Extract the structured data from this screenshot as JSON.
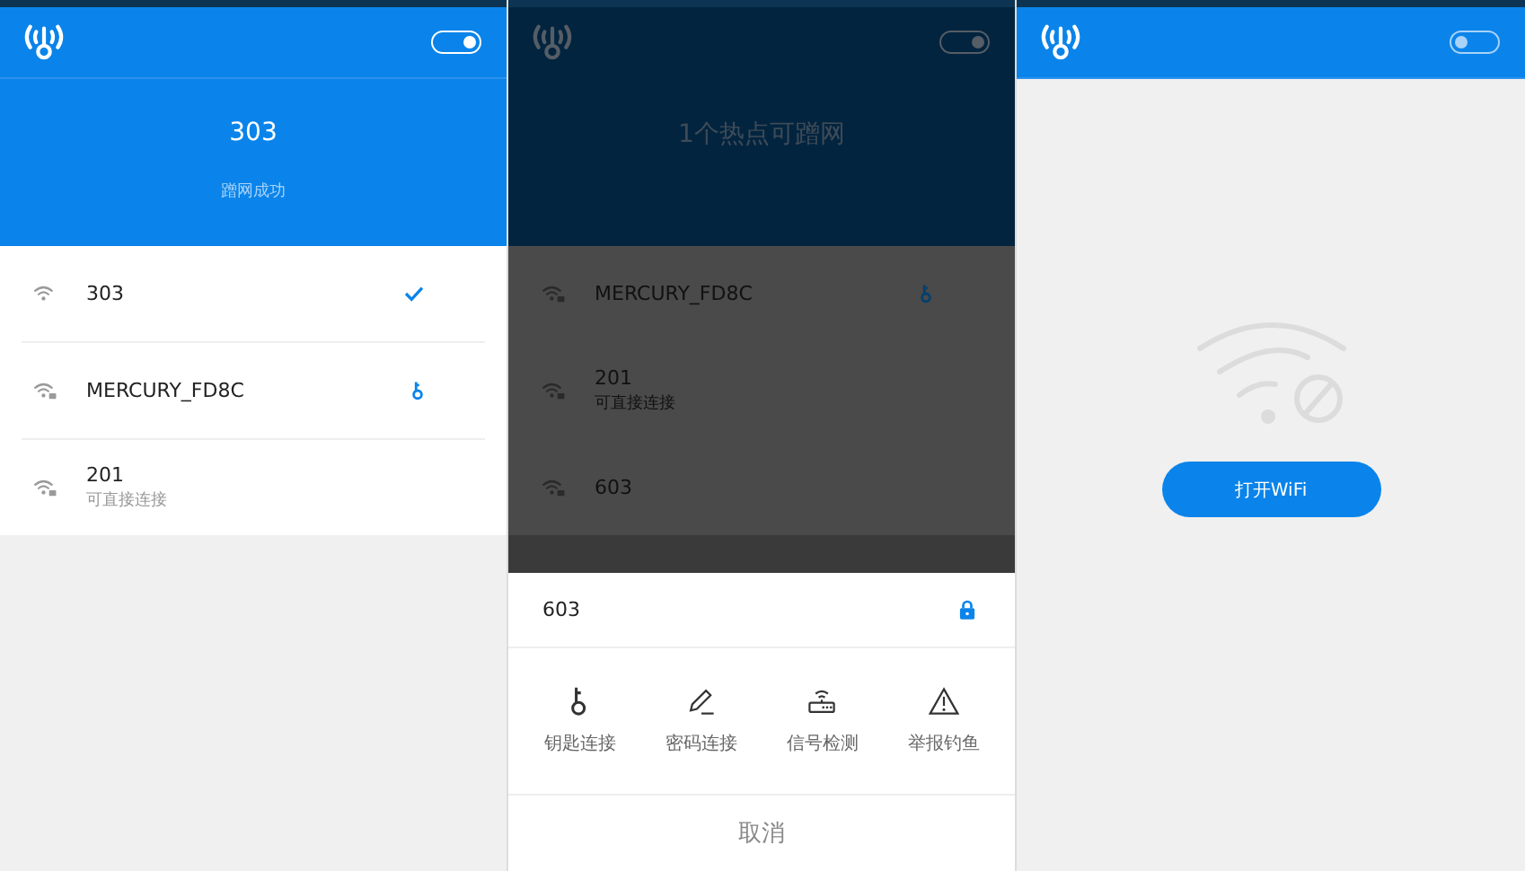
{
  "screens": [
    {
      "kind": "list",
      "dimmed": false,
      "switch_on": true,
      "hero": {
        "title": "303",
        "subtitle": "蹭网成功"
      },
      "networks": [
        {
          "name": "303",
          "locked": false,
          "connected": true,
          "has_key": false
        },
        {
          "name": "MERCURY_FD8C",
          "locked": true,
          "connected": false,
          "has_key": true
        },
        {
          "name": "201",
          "detail": "可直接连接",
          "locked": true,
          "connected": false,
          "has_key": false
        }
      ]
    },
    {
      "kind": "list",
      "dimmed": true,
      "switch_on": true,
      "hero": {
        "title": "1个热点可蹭网"
      },
      "networks": [
        {
          "name": "MERCURY_FD8C",
          "locked": true,
          "connected": false,
          "has_key": true
        },
        {
          "name": "201",
          "detail": "可直接连接",
          "locked": true,
          "connected": false,
          "has_key": false
        },
        {
          "name": "603",
          "locked": true,
          "connected": false,
          "has_key": false
        }
      ],
      "sheet": {
        "network": "603",
        "locked": true,
        "actions": [
          {
            "kind": "key",
            "label": "钥匙连接"
          },
          {
            "kind": "pencil",
            "label": "密码连接"
          },
          {
            "kind": "router",
            "label": "信号检测"
          },
          {
            "kind": "warning",
            "label": "举报钓鱼"
          }
        ],
        "cancel": "取消"
      }
    },
    {
      "kind": "off",
      "dimmed": false,
      "switch_on": false,
      "button": "打开WiFi"
    }
  ]
}
